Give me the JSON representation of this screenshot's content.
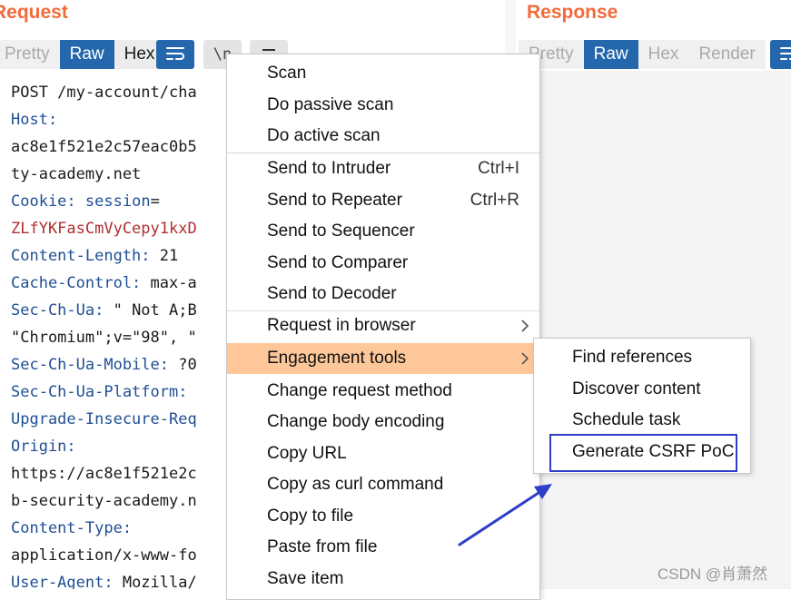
{
  "request": {
    "title": "Request",
    "tabs": [
      "Pretty",
      "Raw",
      "Hex"
    ],
    "icon_text": "\\n",
    "lines": [
      {
        "key": "",
        "text": "POST /my-account/cha"
      },
      {
        "key": "Host:",
        "text": ""
      },
      {
        "key": "",
        "text": "ac8e1f521e2c57eac0b5"
      },
      {
        "key": "",
        "text": "ty-academy.net"
      },
      {
        "key": "Cookie:",
        "ckey": "session",
        "text": "="
      },
      {
        "key": "",
        "text": "ZLfYKFasCmVyCepy1kxD"
      },
      {
        "key": "Content-Length:",
        "text": " 21"
      },
      {
        "key": "Cache-Control:",
        "text": " max-a"
      },
      {
        "key": "Sec-Ch-Ua:",
        "text": " \" Not A;B"
      },
      {
        "key": "",
        "text": "\"Chromium\";v=\"98\", \""
      },
      {
        "key": "Sec-Ch-Ua-Mobile:",
        "text": " ?0"
      },
      {
        "key": "Sec-Ch-Ua-Platform:",
        "text": ""
      },
      {
        "key": "Upgrade-Insecure-Req",
        "text": ""
      },
      {
        "key": "Origin:",
        "text": ""
      },
      {
        "key": "",
        "text": "https://ac8e1f521e2c"
      },
      {
        "key": "",
        "text": "b-security-academy.n"
      },
      {
        "key": "Content-Type:",
        "text": ""
      },
      {
        "key": "",
        "text": "application/x-www-fo"
      },
      {
        "key": "User-Agent:",
        "text": " Mozilla/"
      }
    ]
  },
  "response": {
    "title": "Response",
    "tabs": [
      "Pretty",
      "Raw",
      "Hex",
      "Render"
    ]
  },
  "context_menu": {
    "items": [
      {
        "label": "Scan"
      },
      {
        "label": "Do passive scan"
      },
      {
        "label": "Do active scan"
      },
      {
        "label": "Send to Intruder",
        "shortcut": "Ctrl+I"
      },
      {
        "label": "Send to Repeater",
        "shortcut": "Ctrl+R"
      },
      {
        "label": "Send to Sequencer"
      },
      {
        "label": "Send to Comparer"
      },
      {
        "label": "Send to Decoder"
      },
      {
        "label": "Request in browser",
        "arrow": ">"
      },
      {
        "label": "Engagement tools",
        "arrow": ">"
      },
      {
        "label": "Change request method"
      },
      {
        "label": "Change body encoding"
      },
      {
        "label": "Copy URL"
      },
      {
        "label": "Copy as curl command"
      },
      {
        "label": "Copy to file"
      },
      {
        "label": "Paste from file"
      },
      {
        "label": "Save item"
      }
    ]
  },
  "submenu": {
    "items": [
      {
        "label": "Find references"
      },
      {
        "label": "Discover content"
      },
      {
        "label": "Schedule task"
      },
      {
        "label": "Generate CSRF PoC"
      }
    ]
  },
  "watermark": "CSDN @肖萧然",
  "colors": {
    "title": "#f26b3a",
    "active_tab": "#2467ac",
    "highlight": "#fdc79a",
    "annotation": "#2f3ec8"
  }
}
